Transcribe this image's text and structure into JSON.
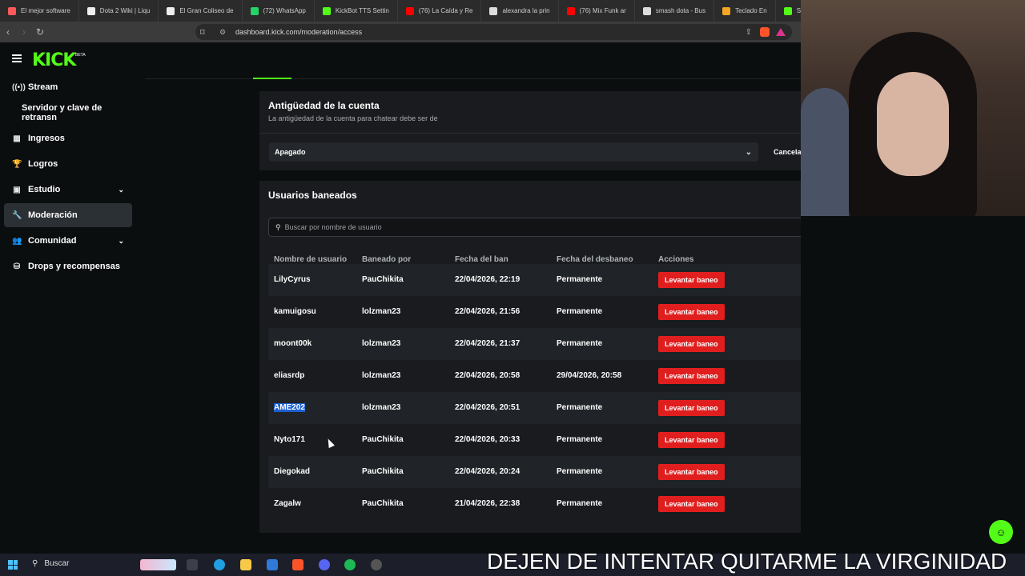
{
  "browser": {
    "tabs": [
      {
        "label": "El mejor software",
        "color": "#ff5a5a"
      },
      {
        "label": "Dota 2 Wiki | Liqu",
        "color": "#eeeeee"
      },
      {
        "label": "El Gran Coliseo de",
        "color": "#eeeeee"
      },
      {
        "label": "(72) WhatsApp",
        "color": "#25d366"
      },
      {
        "label": "KickBot TTS Settin",
        "color": "#53fc18"
      },
      {
        "label": "(76) La Caída y Re",
        "color": "#ff0000"
      },
      {
        "label": "alexandra la prin",
        "color": "#dddddd"
      },
      {
        "label": "(76) Mix Funk ar",
        "color": "#ff0000"
      },
      {
        "label": "smash dota - Bus",
        "color": "#dddddd"
      },
      {
        "label": "Teclado En",
        "color": "#f5a623"
      },
      {
        "label": "Stream",
        "color": "#53fc18"
      }
    ],
    "url": "dashboard.kick.com/moderation/access"
  },
  "logo": {
    "text": "KICK",
    "beta": "BETA"
  },
  "sidebar": {
    "items": [
      {
        "label": "Stream",
        "icon": "stream-icon",
        "glyph": "((•))",
        "chevron": false,
        "active": false
      },
      {
        "label": "Servidor y clave de retransn",
        "icon": "",
        "glyph": "",
        "chevron": false,
        "active": false
      },
      {
        "label": "Ingresos",
        "icon": "chart-icon",
        "glyph": "▦",
        "chevron": false,
        "active": false
      },
      {
        "label": "Logros",
        "icon": "trophy-icon",
        "glyph": "🏆",
        "chevron": false,
        "active": false
      },
      {
        "label": "Estudio",
        "icon": "studio-icon",
        "glyph": "▣",
        "chevron": true,
        "active": false
      },
      {
        "label": "Moderación",
        "icon": "wrench-icon",
        "glyph": "🔧",
        "chevron": false,
        "active": true
      },
      {
        "label": "Comunidad",
        "icon": "community-icon",
        "glyph": "👥",
        "chevron": true,
        "active": false
      },
      {
        "label": "Drops y recompensas",
        "icon": "drops-icon",
        "glyph": "⛁",
        "chevron": false,
        "active": false
      }
    ]
  },
  "account_age": {
    "title": "Antigüedad de la cuenta",
    "subtitle": "La antigüedad de la cuenta para chatear debe ser de",
    "select_value": "Apagado",
    "cancel_label": "Cancela"
  },
  "banned": {
    "title": "Usuarios baneados",
    "search_placeholder": "Buscar por nombre de usuario",
    "columns": [
      "Nombre de usuario",
      "Baneado por",
      "Fecha del ban",
      "Fecha del desbaneo",
      "Acciones"
    ],
    "action_label": "Levantar baneo",
    "rows": [
      {
        "user": "LilyCyrus",
        "by": "PauChikita",
        "date": "22/04/2026, 22:19",
        "unban": "Permanente"
      },
      {
        "user": "kamuigosu",
        "by": "lolzman23",
        "date": "22/04/2026, 21:56",
        "unban": "Permanente"
      },
      {
        "user": "moont00k",
        "by": "lolzman23",
        "date": "22/04/2026, 21:37",
        "unban": "Permanente"
      },
      {
        "user": "eliasrdp",
        "by": "lolzman23",
        "date": "22/04/2026, 20:58",
        "unban": "29/04/2026, 20:58"
      },
      {
        "user": "AME202",
        "by": "lolzman23",
        "date": "22/04/2026, 20:51",
        "unban": "Permanente",
        "selected": true
      },
      {
        "user": "Nyto171",
        "by": "PauChikita",
        "date": "22/04/2026, 20:33",
        "unban": "Permanente"
      },
      {
        "user": "Diegokad",
        "by": "PauChikita",
        "date": "22/04/2026, 20:24",
        "unban": "Permanente"
      },
      {
        "user": "Zagalw",
        "by": "PauChikita",
        "date": "21/04/2026, 22:38",
        "unban": "Permanente"
      }
    ]
  },
  "taskbar": {
    "search_label": "Buscar"
  },
  "overlay_caption": "DEJEN DE INTENTAR QUITARME LA VIRGINIDAD",
  "colors": {
    "kick_green": "#53fc18",
    "ban_red": "#e01e1e"
  }
}
